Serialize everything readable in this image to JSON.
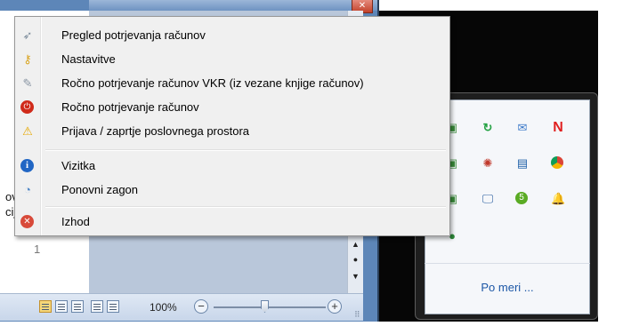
{
  "context_menu": {
    "items": [
      {
        "label": "Pregled potrjevanja računov",
        "icon": "pointer-icon"
      },
      {
        "label": "Nastavitve",
        "icon": "key-icon"
      },
      {
        "label": "Ročno potrjevanje računov VKR (iz vezane knjige računov)",
        "icon": "pen-icon"
      },
      {
        "label": "Ročno potrjevanje računov",
        "icon": "power-icon"
      },
      {
        "label": "Prijava / zaprtje poslovnega prostora",
        "icon": "warning-icon"
      },
      {
        "label": "Vizitka",
        "icon": "info-icon"
      },
      {
        "label": "Ponovni zagon",
        "icon": "refresh-icon"
      },
      {
        "label": "Izhod",
        "icon": "exit-icon"
      }
    ]
  },
  "document": {
    "snippet_1": "ov",
    "snippet_2": "cij",
    "line_number": "1"
  },
  "statusbar": {
    "zoom_label": "100%",
    "zoom_level_percent": 100,
    "zoom_minus": "−",
    "zoom_plus": "+"
  },
  "tray": {
    "customize_link": "Po meri ...",
    "icons": [
      "green-arrow-icon",
      "mail-icon",
      "n-logo-icon",
      "app-icon",
      "colorful-app-icon",
      "network-icon",
      "chrome-icon",
      "monitor-icon",
      "badge-5-icon",
      "bell-icon"
    ]
  },
  "colors": {
    "menu_bg": "#f0f0f0",
    "link": "#1c57a6",
    "window_frame": "#5d86b8"
  }
}
